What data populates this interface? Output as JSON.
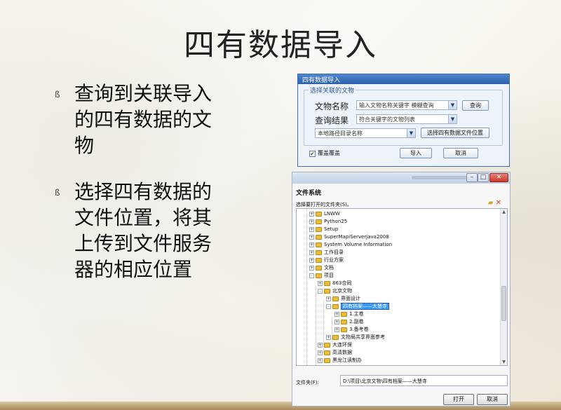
{
  "slide": {
    "title": "四有数据导入",
    "bullets": [
      {
        "marker": "ß",
        "text": "查询到关联导入的四有数据的文物"
      },
      {
        "marker": "ß",
        "text": "选择四有数据的文件位置，将其上传到文件服务器的相应位置"
      }
    ]
  },
  "import_dialog": {
    "title": "四有数据导入",
    "group_label": "选择关联的文物",
    "name_label": "文物名称",
    "name_input": "输入文物名称关键字 模糊查询",
    "query_button": "查询",
    "result_label": "查询结果",
    "result_select": "符合关键字的文物列表",
    "path_select": "本地路径目录名称",
    "choose_location_button": "选择四有数据文件位置",
    "overwrite_check": "覆盖覆盖",
    "overwrite_checked": true,
    "import_button": "导入",
    "cancel_button": "取消"
  },
  "file_dialog": {
    "title": "文件系统",
    "subtitle": "选择要打开的文件夹(S)。",
    "tree": [
      {
        "label": "LNWW",
        "level": 2,
        "sign": "+"
      },
      {
        "label": "Python25",
        "level": 2,
        "sign": "+"
      },
      {
        "label": "Setup",
        "level": 2,
        "sign": "+"
      },
      {
        "label": "SuperMapiServerJava2008",
        "level": 2,
        "sign": "+"
      },
      {
        "label": "System Volume Information",
        "level": 2,
        "sign": "+"
      },
      {
        "label": "工作目录",
        "level": 2,
        "sign": "+"
      },
      {
        "label": "行业方案",
        "level": 2,
        "sign": "+"
      },
      {
        "label": "文档",
        "level": 2,
        "sign": "+"
      },
      {
        "label": "项目",
        "level": 2,
        "sign": "-"
      },
      {
        "label": "863合同",
        "level": 3,
        "sign": "+"
      },
      {
        "label": "北京文物",
        "level": 3,
        "sign": "-"
      },
      {
        "label": "界面设计",
        "level": 4,
        "sign": "+"
      },
      {
        "label": "四有档案——大慧寺",
        "level": 4,
        "sign": "-",
        "selected": true
      },
      {
        "label": "1.主卷",
        "level": 5,
        "sign": "+"
      },
      {
        "label": "2.副卷",
        "level": 5,
        "sign": "+"
      },
      {
        "label": "3.备考卷",
        "level": 5,
        "sign": "+"
      },
      {
        "label": "文物局共享界面参考",
        "level": 4,
        "sign": "+"
      },
      {
        "label": "大连环保",
        "level": 3,
        "sign": "+"
      },
      {
        "label": "高清数据",
        "level": 3,
        "sign": "+"
      },
      {
        "label": "黑龙江读制办",
        "level": 3,
        "sign": "+"
      }
    ],
    "path_label": "文件夹(F):",
    "path_value": "D:\\项目\\北京文物\\四有档案——大慧寺",
    "open_button": "打开",
    "cancel_button": "取消"
  }
}
